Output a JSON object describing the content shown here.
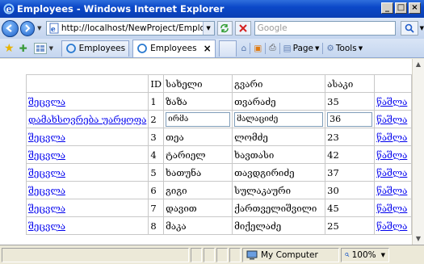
{
  "window": {
    "title": "Employees - Windows Internet Explorer"
  },
  "navbar": {
    "address": "http://localhost/NewProject/Employe",
    "search_placeholder": "Google"
  },
  "tabs": [
    {
      "label": "Employees"
    },
    {
      "label": "Employees"
    }
  ],
  "commands": {
    "page": "Page",
    "tools": "Tools"
  },
  "table": {
    "headers": [
      "",
      "ID",
      "სახელი",
      "გვარი",
      "ასაკი",
      ""
    ],
    "rows": [
      {
        "action": "შეცვლა",
        "id": "1",
        "first": "ზაზა",
        "last": "თვარაძე",
        "age": "35",
        "delete": "წაშლა"
      },
      {
        "action": "დამახსოვრება უარყოფა",
        "id": "2",
        "first": "ირმა",
        "last": "მალაციძე",
        "age": "36",
        "delete": "წაშლა",
        "editing": true
      },
      {
        "action": "შეცვლა",
        "id": "3",
        "first": "თეა",
        "last": "ლომძე",
        "age": "23",
        "delete": "წაშლა"
      },
      {
        "action": "შეცვლა",
        "id": "4",
        "first": "ტარიელ",
        "last": "ხავთასი",
        "age": "42",
        "delete": "წაშლა"
      },
      {
        "action": "შეცვლა",
        "id": "5",
        "first": "ხათუნა",
        "last": "თავდგირიძე",
        "age": "37",
        "delete": "წაშლა"
      },
      {
        "action": "შეცვლა",
        "id": "6",
        "first": "გიგი",
        "last": "სულაკაური",
        "age": "30",
        "delete": "წაშლა"
      },
      {
        "action": "შეცვლა",
        "id": "7",
        "first": "დავით",
        "last": "ქართველიშვილი",
        "age": "45",
        "delete": "წაშლა"
      },
      {
        "action": "შეცვლა",
        "id": "8",
        "first": "მაკა",
        "last": "მიქელაძე",
        "age": "25",
        "delete": "წაშლა"
      }
    ]
  },
  "status": {
    "zone": "My Computer",
    "zoom": "100%"
  },
  "colors": {
    "titlebar": "#0b48c8",
    "link": "#0000ee"
  }
}
